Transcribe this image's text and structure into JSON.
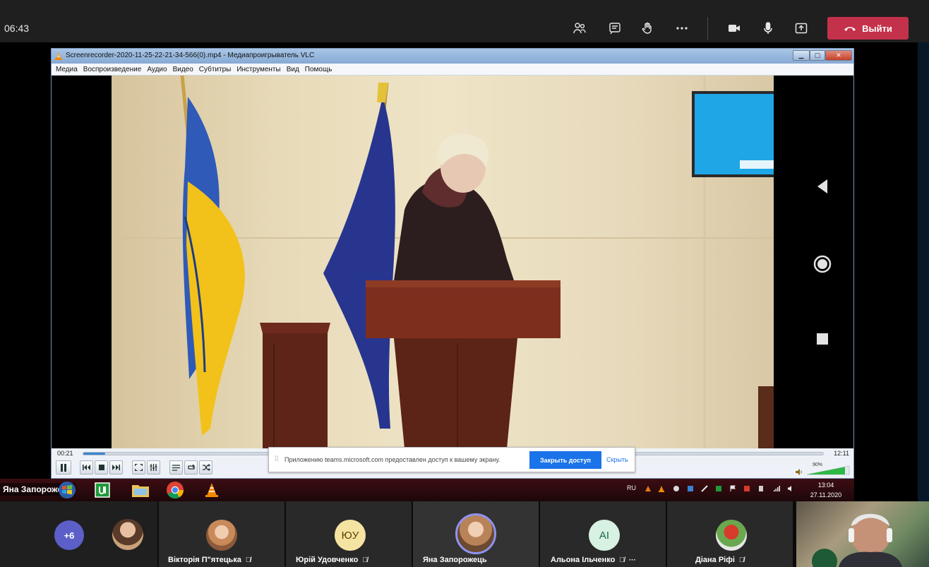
{
  "meeting": {
    "timer": "06:43",
    "leave_label": "Выйти",
    "toolbar_icons": [
      "participants-icon",
      "chat-icon",
      "raise-hand-icon",
      "more-icon",
      "camera-icon",
      "microphone-icon",
      "share-screen-icon"
    ]
  },
  "vlc": {
    "title": "Screenrecorder-2020-11-25-22-21-34-566(0).mp4 - Медиапроигрыватель VLC",
    "menu": [
      "Медиа",
      "Воспроизведение",
      "Аудио",
      "Видео",
      "Субтитры",
      "Инструменты",
      "Вид",
      "Помощь"
    ],
    "time_elapsed": "00:21",
    "time_total": "12:11",
    "progress": 0.03,
    "volume_label": "90%",
    "volume": 0.9
  },
  "notification": {
    "text": "Приложению teams.microsoft.com предоставлен доступ к вашему экрану.",
    "stop_label": "Закрыть доступ",
    "hide_label": "Скрыть"
  },
  "taskbar": {
    "presenter_name": "Яна Запорожець",
    "lang": "RU",
    "clock_time": "13:04",
    "clock_date": "27.11.2020"
  },
  "participants": {
    "more_count": "+6",
    "tiles": [
      {
        "name": "Вікторія П\"ятецька",
        "initials": "",
        "muted": true
      },
      {
        "name": "Юрій Удовченко",
        "initials": "ЮУ",
        "muted": true
      },
      {
        "name": "Яна Запорожець",
        "initials": "",
        "muted": false
      },
      {
        "name": "Альона Ільченко",
        "initials": "AI",
        "muted": true
      },
      {
        "name": "Діана Ріфі",
        "initials": "",
        "muted": true
      }
    ]
  },
  "colors": {
    "leave": "#c4314b",
    "teams_purple": "#5b5fc7",
    "vlc_progress": "#3d83d3",
    "share_button": "#1a73e8"
  }
}
